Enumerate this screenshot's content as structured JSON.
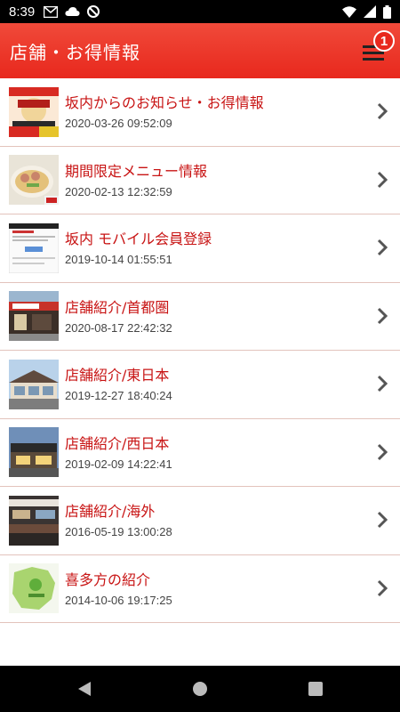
{
  "status_bar": {
    "time": "8:39"
  },
  "app_bar": {
    "title": "店舗・お得情報",
    "badge_count": "1"
  },
  "items": [
    {
      "title": "坂内からのお知らせ・お得情報",
      "date": "2020-03-26 09:52:09",
      "thumb": "promo-flyer"
    },
    {
      "title": "期間限定メニュー情報",
      "date": "2020-02-13 12:32:59",
      "thumb": "ramen-bowl"
    },
    {
      "title": "坂内 モバイル会員登録",
      "date": "2019-10-14 01:55:51",
      "thumb": "webpage"
    },
    {
      "title": "店舗紹介/首都圏",
      "date": "2020-08-17 22:42:32",
      "thumb": "shop-front"
    },
    {
      "title": "店舗紹介/東日本",
      "date": "2019-12-27 18:40:24",
      "thumb": "shop-building"
    },
    {
      "title": "店舗紹介/西日本",
      "date": "2019-02-09 14:22:41",
      "thumb": "shop-night"
    },
    {
      "title": "店舗紹介/海外",
      "date": "2016-05-19 13:00:28",
      "thumb": "restaurant-interior"
    },
    {
      "title": "喜多方の紹介",
      "date": "2014-10-06 19:17:25",
      "thumb": "map"
    }
  ],
  "colors": {
    "accent": "#e8281d",
    "title_text": "#c81414",
    "divider": "#e3c3bc"
  }
}
